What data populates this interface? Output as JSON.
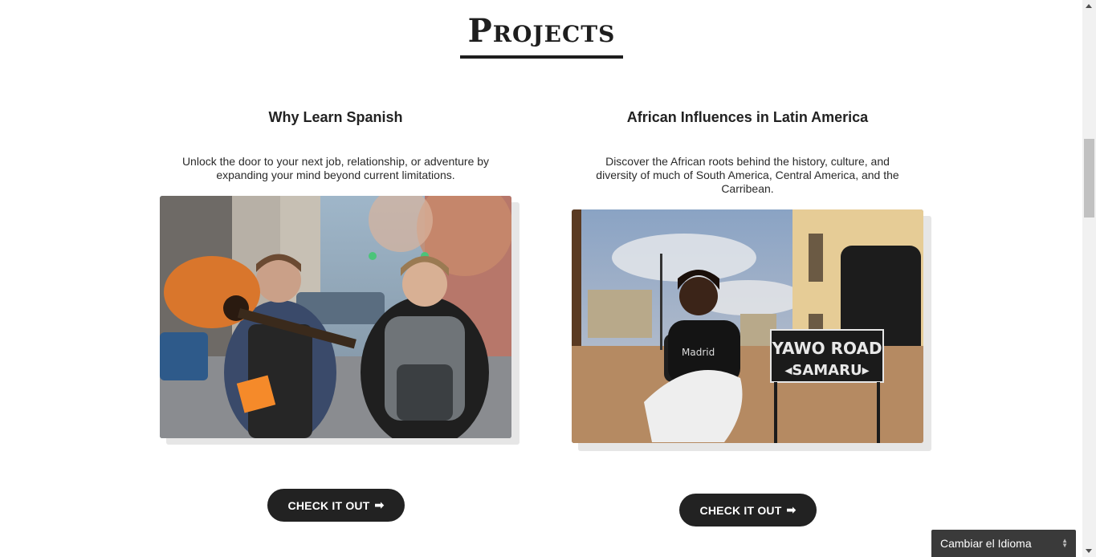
{
  "section": {
    "title": "Projects"
  },
  "cards": [
    {
      "title": "Why Learn Spanish",
      "description": "Unlock the door to your next job, relationship, or adventure by expanding your mind beyond current limitations.",
      "button_label": "CHECK IT OUT",
      "button_icon": "➡"
    },
    {
      "title": "African Influences in Latin America",
      "description": "Discover the African roots behind the history, culture, and diversity of much of South America, Central America, and the Carribean.",
      "button_label": "CHECK IT OUT",
      "button_icon": "➡",
      "sign_line1": "YAWO ROAD",
      "sign_line2": "◂SAMARU▸"
    }
  ],
  "language_selector": {
    "label": "Cambiar el Idioma"
  },
  "colors": {
    "text": "#222222",
    "button_bg": "#222222",
    "button_text": "#ffffff",
    "selector_bg": "#3a3a3a"
  }
}
